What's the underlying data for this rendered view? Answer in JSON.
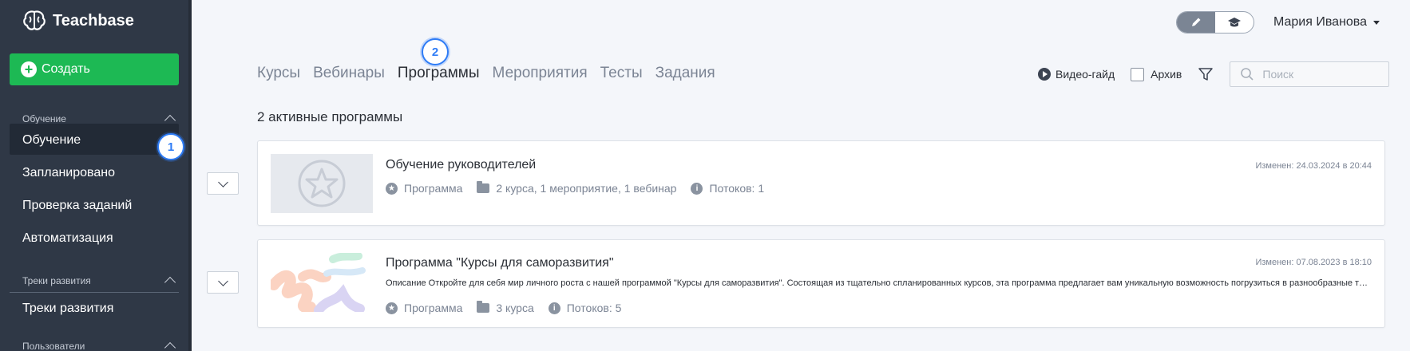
{
  "app": {
    "name": "Teachbase"
  },
  "sidebar": {
    "create_label": "Создать",
    "sections": [
      {
        "title": "Обучение",
        "items": [
          "Обучение",
          "Запланировано",
          "Проверка заданий",
          "Автоматизация"
        ]
      },
      {
        "title": "Треки развития",
        "items": [
          "Треки развития"
        ]
      },
      {
        "title": "Пользователи",
        "items": []
      }
    ],
    "active_badge": "1"
  },
  "header": {
    "user_name": "Мария Иванова"
  },
  "tabs": {
    "items": [
      "Курсы",
      "Вебинары",
      "Программы",
      "Мероприятия",
      "Тесты",
      "Задания"
    ],
    "active": "Программы",
    "badge": "2"
  },
  "toolbar": {
    "video_guide": "Видео-гайд",
    "archive": "Архив",
    "search_placeholder": "Поиск"
  },
  "content": {
    "count_label": "2 активные программы",
    "cards": [
      {
        "title": "Обучение руководителей",
        "modified": "Изменен: 24.03.2024 в 20:44",
        "type": "Программа",
        "contents": "2 курса, 1 мероприятие, 1 вебинар",
        "streams": "Потоков: 1"
      },
      {
        "title": "Программа \"Курсы для саморазвития\"",
        "modified": "Изменен: 07.08.2023 в 18:10",
        "description": "Описание Откройте для себя мир личного роста с нашей программой \"Курсы для саморазвития\". Состоящая из тщательно спланированных курсов, эта программа предлагает вам уникальную возможность погрузиться в разнообразные темы.",
        "type": "Программа",
        "contents": "3 курса",
        "streams": "Потоков: 5"
      }
    ]
  },
  "colors": {
    "sidebar": "#2f3846",
    "create": "#1db954",
    "badge": "#2e7cf6"
  }
}
